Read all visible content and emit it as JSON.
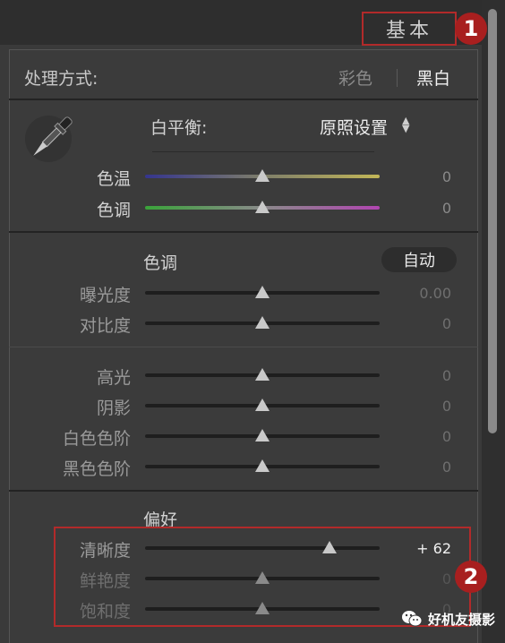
{
  "header": {
    "title": "基本",
    "marker_1": "1",
    "marker_2": "2"
  },
  "treatment": {
    "label": "处理方式:",
    "color": "彩色",
    "bw": "黑白",
    "selected": "黑白"
  },
  "white_balance": {
    "label": "白平衡:",
    "value": "原照设置",
    "arrows": "▲▼",
    "temp": {
      "label": "色温",
      "value": "0",
      "position": 0.5
    },
    "tint": {
      "label": "色调",
      "value": "0",
      "position": 0.5
    }
  },
  "tone": {
    "title": "色调",
    "auto": "自动",
    "exposure": {
      "label": "曝光度",
      "value": "0.00",
      "position": 0.5
    },
    "contrast": {
      "label": "对比度",
      "value": "0",
      "position": 0.5
    },
    "highlights": {
      "label": "高光",
      "value": "0",
      "position": 0.5
    },
    "shadows": {
      "label": "阴影",
      "value": "0",
      "position": 0.5
    },
    "whites": {
      "label": "白色色阶",
      "value": "0",
      "position": 0.5
    },
    "blacks": {
      "label": "黑色色阶",
      "value": "0",
      "position": 0.5
    }
  },
  "presence": {
    "title": "偏好",
    "clarity": {
      "label": "清晰度",
      "value": "+ 62",
      "position": 0.81
    },
    "vibrance": {
      "label": "鲜艳度",
      "value": "0",
      "position": 0.5
    },
    "saturation": {
      "label": "饱和度",
      "value": "0",
      "position": 0.5
    }
  },
  "watermark": {
    "text": "好机友摄影"
  },
  "colors": {
    "accent_red": "#b22a2a",
    "panel": "#3b3b3b",
    "header": "#2e2e2e"
  },
  "icons": {
    "eyedropper": "eyedropper-icon",
    "select": "select-arrows-icon",
    "watermark": "wechat-icon"
  }
}
